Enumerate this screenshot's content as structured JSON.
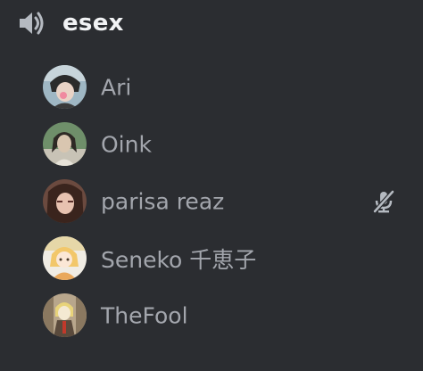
{
  "channel": {
    "name": "esex",
    "icon": "speaker-icon"
  },
  "users": [
    {
      "name": "Ari",
      "muted": false,
      "avatar_colors": [
        "#9fb7c4",
        "#2b2b2b",
        "#e9d3c6"
      ]
    },
    {
      "name": "Oink",
      "muted": false,
      "avatar_colors": [
        "#6f8f6a",
        "#2e2a25",
        "#d9c6b0"
      ]
    },
    {
      "name": "parisa reaz",
      "muted": true,
      "avatar_colors": [
        "#6b4a3f",
        "#3a241d",
        "#e7c2b0"
      ]
    },
    {
      "name": "Seneko 千恵子",
      "muted": false,
      "avatar_colors": [
        "#e6d7a8",
        "#f2c76a",
        "#f0ece4"
      ]
    },
    {
      "name": "TheFool",
      "muted": false,
      "avatar_colors": [
        "#b8a68c",
        "#5a4a3c",
        "#f4e9d2"
      ]
    }
  ],
  "colors": {
    "background": "#2b2d31",
    "channel_text": "#f2f3f5",
    "user_text": "#a3a6ad",
    "icon": "#b5bac1"
  }
}
